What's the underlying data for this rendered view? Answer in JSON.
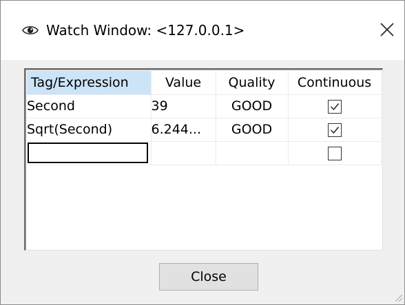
{
  "window": {
    "title": "Watch Window: <127.0.0.1>"
  },
  "icons": {
    "title_icon": "eye-icon",
    "close_icon": "close-icon",
    "checkbox_checked": "checkmark-icon",
    "resize": "resize-grip-icon"
  },
  "grid": {
    "columns": [
      "Tag/Expression",
      "Value",
      "Quality",
      "Continuous"
    ],
    "rows": [
      {
        "tag": "Second",
        "value": "39",
        "quality": "GOOD",
        "continuous": true
      },
      {
        "tag": "Sqrt(Second)",
        "value": "6.244...",
        "quality": "GOOD",
        "continuous": true
      },
      {
        "tag": "",
        "value": "",
        "quality": "",
        "continuous": false
      }
    ]
  },
  "buttons": {
    "close_label": "Close"
  },
  "colors": {
    "header_selected": "#cce4f7",
    "dialog_bg": "#f0f0f0",
    "button_bg": "#e1e1e1"
  }
}
